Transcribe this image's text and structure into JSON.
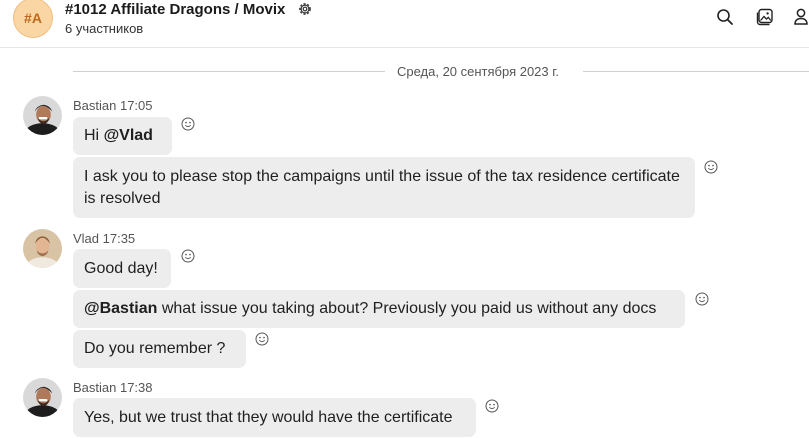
{
  "header": {
    "avatar_text": "#A",
    "title": "#1012 Affiliate Dragons / Movix",
    "subtitle": "6 участников"
  },
  "date_separator": "Среда, 20 сентября 2023 г.",
  "messages": [
    {
      "sender_line": "Bastian 17:05",
      "mention": "@Vlad",
      "text": "Hi "
    },
    {
      "text": "I ask you to please stop the campaigns until the issue of the tax residence certificate is resolved"
    },
    {
      "sender_line": "Vlad 17:35",
      "text": "Good day!"
    },
    {
      "mention": "@Bastian",
      "text": " what issue you taking about? Previously you paid us without any docs"
    },
    {
      "text": "Do you remember ?"
    },
    {
      "sender_line": "Bastian 17:38",
      "text": "Yes, but we trust that they would have the certificate"
    }
  ],
  "icons": [
    "gear-icon",
    "search-icon",
    "gallery-icon",
    "members-icon",
    "add-reaction-icon"
  ]
}
